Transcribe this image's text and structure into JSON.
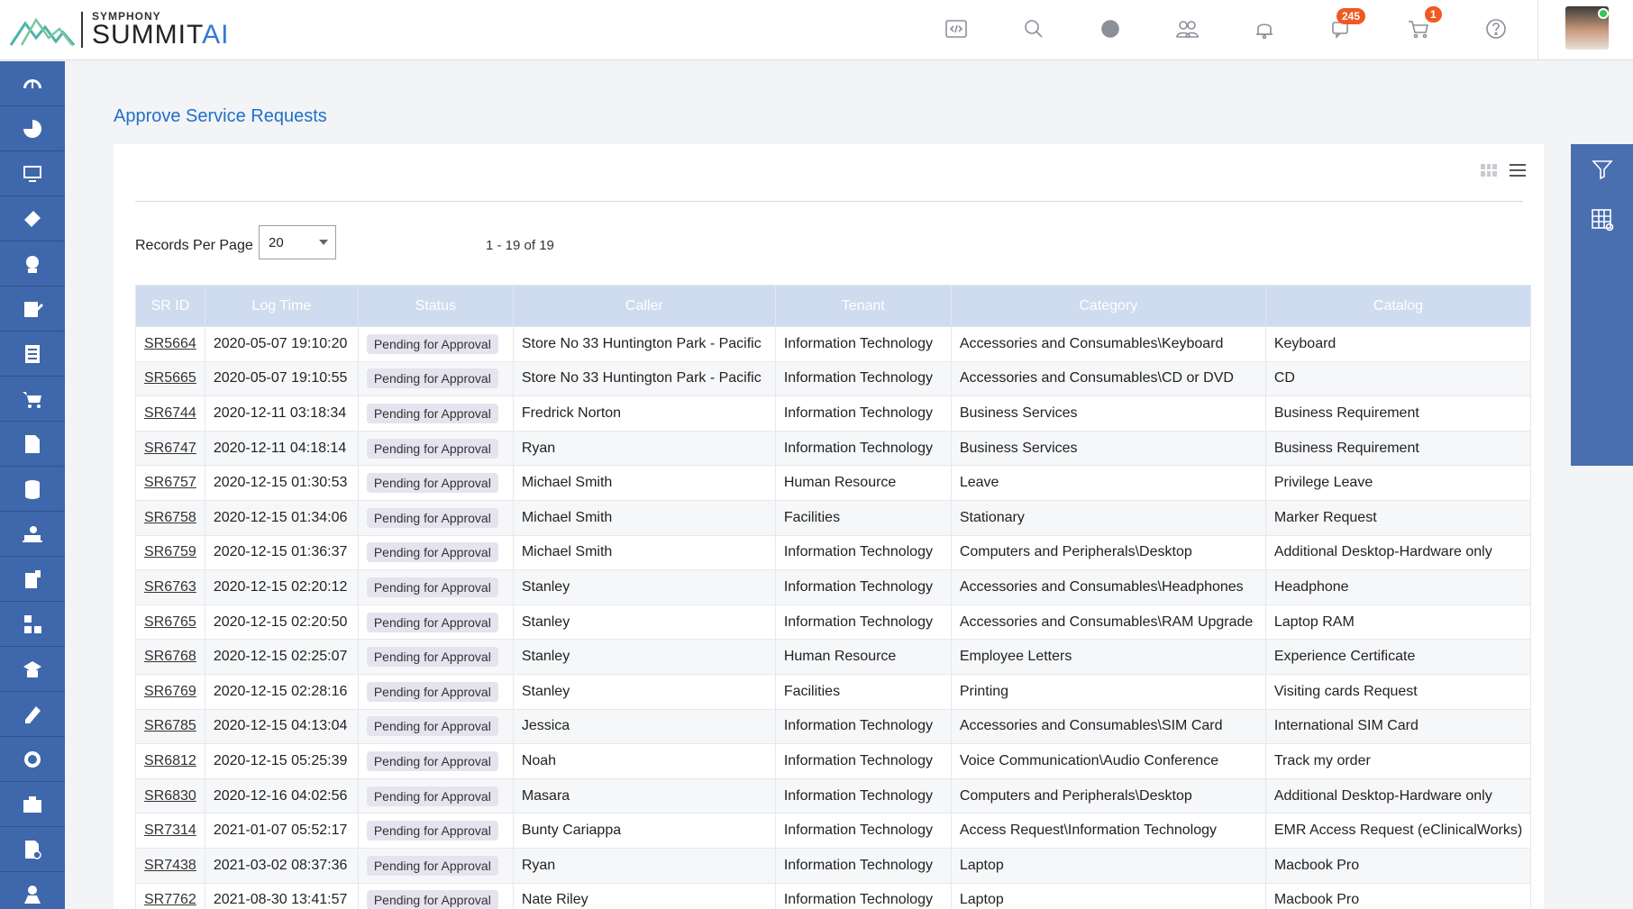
{
  "brand": {
    "small": "SYMPHONY",
    "main": "SUMMIT",
    "ai": "AI"
  },
  "header": {
    "notifications_badge": "245",
    "cart_badge": "1",
    "accent_color": "#3f67ab",
    "badge_color": "#f05a22",
    "icons": [
      "code-icon",
      "search-icon",
      "globe-icon",
      "users-icon",
      "bell-icon",
      "chat-icon",
      "cart-icon",
      "help-icon"
    ]
  },
  "sidebar": {
    "icons": [
      "dashboard-icon",
      "pie-chart-icon",
      "monitor-icon",
      "ticket-icon",
      "user-support-icon",
      "edit-icon",
      "report-icon",
      "service-cart-icon",
      "document-edit-icon",
      "database-icon",
      "laptop-user-icon",
      "mobile-icon",
      "hierarchy-icon",
      "knowledge-icon",
      "pen-icon",
      "handshake-icon",
      "briefcase-icon",
      "approval-icon",
      "person-icon"
    ]
  },
  "page": {
    "title": "Approve Service Requests"
  },
  "controls": {
    "records_per_page_label": "Records Per Page",
    "records_per_page_value": "20",
    "pager_text": "1 - 19 of 19"
  },
  "table": {
    "columns": [
      "SR ID",
      "Log Time",
      "Status",
      "Caller",
      "Tenant",
      "Category",
      "Catalog"
    ],
    "rows": [
      [
        "SR5664",
        "2020-05-07 19:10:20",
        "Pending for Approval",
        "Store No 33 Huntington Park - Pacific",
        "Information Technology",
        "Accessories and Consumables\\Keyboard",
        "Keyboard"
      ],
      [
        "SR5665",
        "2020-05-07 19:10:55",
        "Pending for Approval",
        "Store No 33 Huntington Park - Pacific",
        "Information Technology",
        "Accessories and Consumables\\CD or DVD",
        "CD"
      ],
      [
        "SR6744",
        "2020-12-11 03:18:34",
        "Pending for Approval",
        "Fredrick Norton",
        "Information Technology",
        "Business Services",
        "Business Requirement"
      ],
      [
        "SR6747",
        "2020-12-11 04:18:14",
        "Pending for Approval",
        "Ryan",
        "Information Technology",
        "Business Services",
        "Business Requirement"
      ],
      [
        "SR6757",
        "2020-12-15 01:30:53",
        "Pending for Approval",
        "Michael Smith",
        "Human Resource",
        "Leave",
        "Privilege Leave"
      ],
      [
        "SR6758",
        "2020-12-15 01:34:06",
        "Pending for Approval",
        "Michael Smith",
        "Facilities",
        "Stationary",
        "Marker Request"
      ],
      [
        "SR6759",
        "2020-12-15 01:36:37",
        "Pending for Approval",
        "Michael Smith",
        "Information Technology",
        "Computers and Peripherals\\Desktop",
        "Additional Desktop-Hardware only"
      ],
      [
        "SR6763",
        "2020-12-15 02:20:12",
        "Pending for Approval",
        "Stanley",
        "Information Technology",
        "Accessories and Consumables\\Headphones",
        "Headphone"
      ],
      [
        "SR6765",
        "2020-12-15 02:20:50",
        "Pending for Approval",
        "Stanley",
        "Information Technology",
        "Accessories and Consumables\\RAM Upgrade",
        "Laptop RAM"
      ],
      [
        "SR6768",
        "2020-12-15 02:25:07",
        "Pending for Approval",
        "Stanley",
        "Human Resource",
        "Employee Letters",
        "Experience Certificate"
      ],
      [
        "SR6769",
        "2020-12-15 02:28:16",
        "Pending for Approval",
        "Stanley",
        "Facilities",
        "Printing",
        "Visiting cards Request"
      ],
      [
        "SR6785",
        "2020-12-15 04:13:04",
        "Pending for Approval",
        "Jessica",
        "Information Technology",
        "Accessories and Consumables\\SIM Card",
        "International SIM Card"
      ],
      [
        "SR6812",
        "2020-12-15 05:25:39",
        "Pending for Approval",
        "Noah",
        "Information Technology",
        "Voice Communication\\Audio Conference",
        "Track my order"
      ],
      [
        "SR6830",
        "2020-12-16 04:02:56",
        "Pending for Approval",
        "Masara",
        "Information Technology",
        "Computers and Peripherals\\Desktop",
        "Additional Desktop-Hardware only"
      ],
      [
        "SR7314",
        "2021-01-07 05:52:17",
        "Pending for Approval",
        "Bunty Cariappa",
        "Information Technology",
        "Access Request\\Information Technology",
        "EMR Access Request (eClinicalWorks)"
      ],
      [
        "SR7438",
        "2021-03-02 08:37:36",
        "Pending for Approval",
        "Ryan",
        "Information Technology",
        "Laptop",
        "Macbook Pro"
      ],
      [
        "SR7762",
        "2021-08-30 13:41:57",
        "Pending for Approval",
        "Nate Riley",
        "Information Technology",
        "Laptop",
        "Macbook Pro"
      ]
    ]
  },
  "right_rail": {
    "icons": [
      "filter-icon",
      "table-settings-icon"
    ]
  }
}
